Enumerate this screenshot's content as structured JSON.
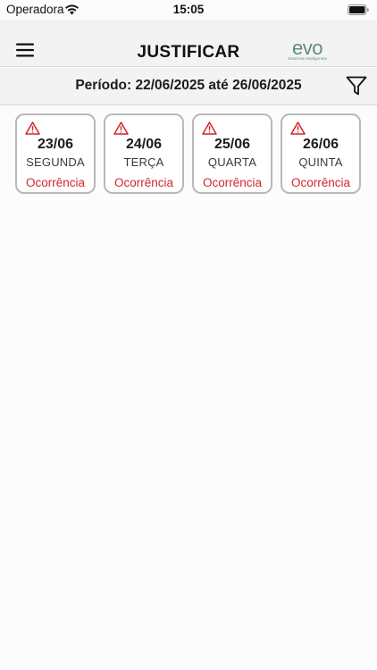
{
  "status_bar": {
    "carrier": "Operadora",
    "time": "15:05"
  },
  "header": {
    "title": "JUSTIFICAR",
    "logo": {
      "mark": "evo",
      "tagline": "Sistemas Inteligentes",
      "color": "#5f8f77"
    }
  },
  "filter": {
    "period_text": "Período: 22/06/2025 até 26/06/2025"
  },
  "days": [
    {
      "date": "23/06",
      "weekday": "SEGUNDA",
      "status": "Ocorrência"
    },
    {
      "date": "24/06",
      "weekday": "TERÇA",
      "status": "Ocorrência"
    },
    {
      "date": "25/06",
      "weekday": "QUARTA",
      "status": "Ocorrência"
    },
    {
      "date": "26/06",
      "weekday": "QUINTA",
      "status": "Ocorrência"
    }
  ],
  "colors": {
    "warning": "#d1262b",
    "card_border": "#b8b8b8",
    "header_bg": "#f3f3f3"
  }
}
